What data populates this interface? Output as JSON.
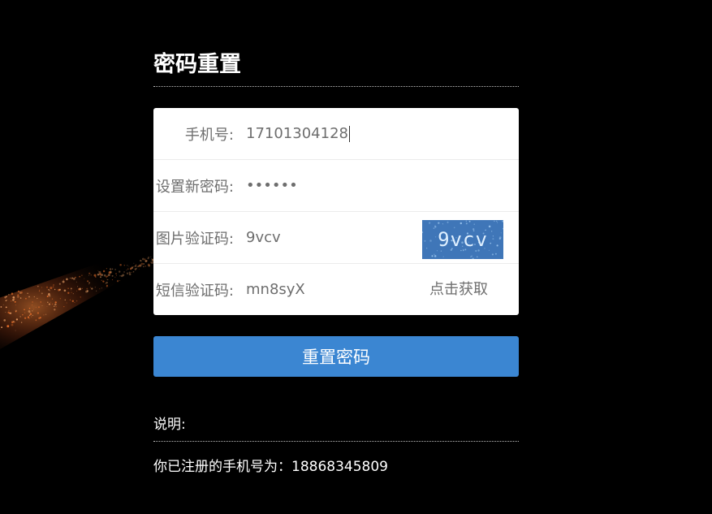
{
  "page": {
    "title": "密码重置"
  },
  "form": {
    "phone_label": "手机号:",
    "phone_value": "17101304128",
    "password_label": "设置新密码:",
    "password_value": "••••••",
    "captcha_label": "图片验证码:",
    "captcha_value": "9vcv",
    "captcha_image_text": "9vcv",
    "sms_label": "短信验证码:",
    "sms_value": "mn8syX",
    "sms_get_label": "点击获取",
    "submit_label": "重置密码"
  },
  "note": {
    "heading": "说明:",
    "text": "你已注册的手机号为：18868345809"
  },
  "colors": {
    "background": "#000000",
    "card": "#ffffff",
    "button": "#3b86d2",
    "captcha_bg": "#3f76b8",
    "label_text": "#6e6e6e"
  }
}
